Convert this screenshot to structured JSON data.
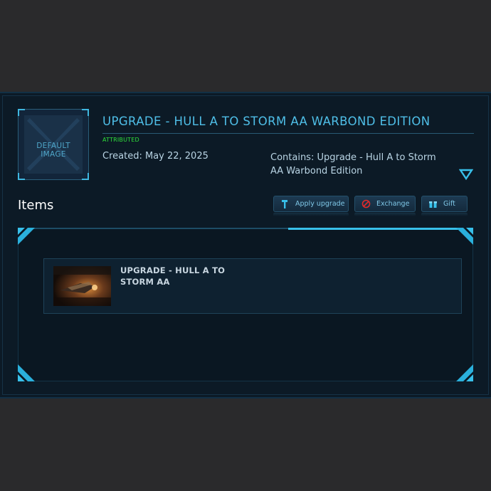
{
  "pledge": {
    "thumbnail_text_line1": "DEFAULT",
    "thumbnail_text_line2": "IMAGE",
    "title": "UPGRADE - HULL A TO STORM AA WARBOND EDITION",
    "badge": "ATTRIBUTED",
    "created": "Created: May 22, 2025",
    "contains": "Contains: Upgrade - Hull A to Storm AA Warbond Edition"
  },
  "items_section": {
    "heading": "Items",
    "buttons": [
      {
        "label": "Apply upgrade",
        "icon": "wrench-icon"
      },
      {
        "label": "Exchange",
        "icon": "exchange-icon"
      },
      {
        "label": "Gift",
        "icon": "gift-icon"
      }
    ],
    "list": [
      {
        "title": "UPGRADE - HULL A TO STORM AA",
        "image": "ship-image"
      }
    ]
  },
  "colors": {
    "accent": "#38c0ea",
    "title": "#4fbfe8",
    "badge": "#2fe03a",
    "panel": "#0c1a26",
    "page_bg": "#2a2a2c"
  }
}
